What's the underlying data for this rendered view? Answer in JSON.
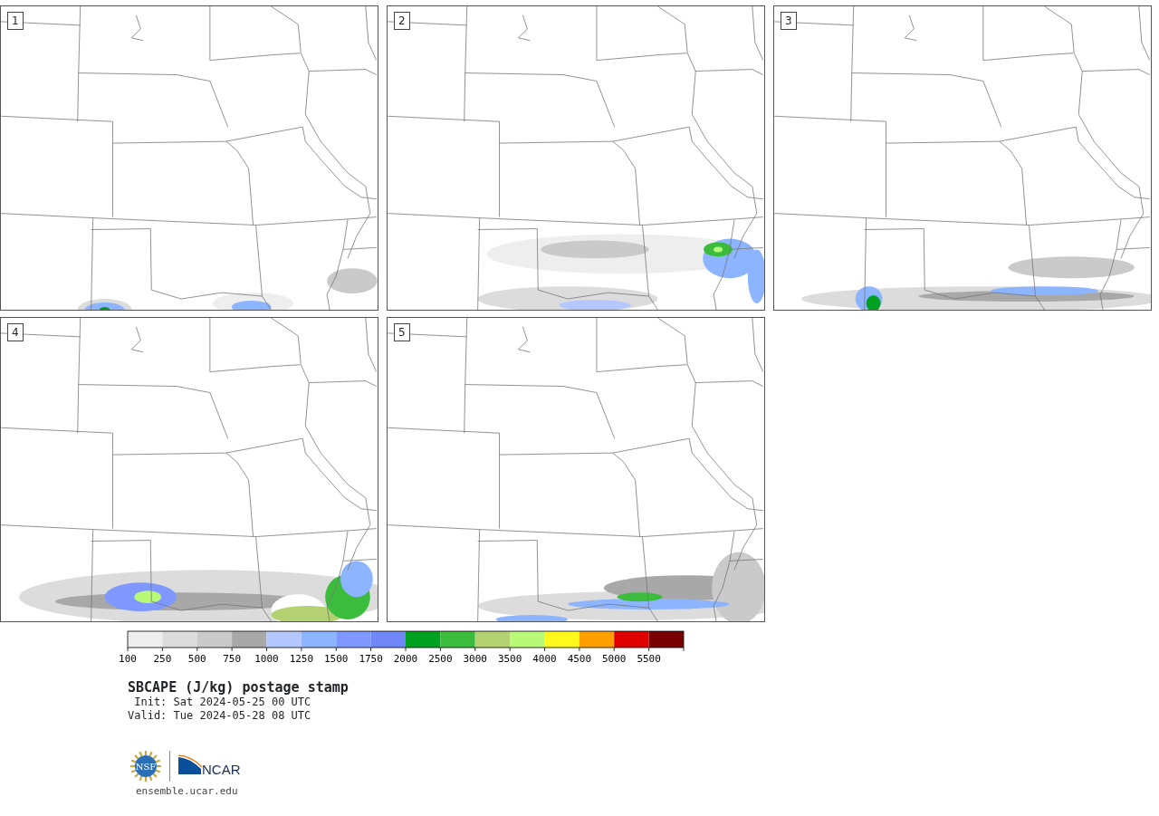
{
  "panels": [
    {
      "label": "1"
    },
    {
      "label": "2"
    },
    {
      "label": "3"
    },
    {
      "label": "4"
    },
    {
      "label": "5"
    }
  ],
  "colorbar": {
    "bins": [
      {
        "color": "#eeeeee"
      },
      {
        "color": "#dcdcdc"
      },
      {
        "color": "#cacaca"
      },
      {
        "color": "#a8a8a8"
      },
      {
        "color": "#b4c8ff"
      },
      {
        "color": "#8cb4ff"
      },
      {
        "color": "#7f98ff"
      },
      {
        "color": "#7088f8"
      },
      {
        "color": "#00a020"
      },
      {
        "color": "#3cbc3c"
      },
      {
        "color": "#b4d272"
      },
      {
        "color": "#b8fa78"
      },
      {
        "color": "#fff81c"
      },
      {
        "color": "#ffa000"
      },
      {
        "color": "#e10000"
      },
      {
        "color": "#780000"
      }
    ],
    "tick_labels": [
      "100",
      "250",
      "500",
      "750",
      "1000",
      "1250",
      "1500",
      "1750",
      "2000",
      "2500",
      "3000",
      "3500",
      "4000",
      "4500",
      "5000",
      "5500"
    ]
  },
  "title": "SBCAPE (J/kg) postage stamp",
  "init": " Init: Sat 2024-05-25 00 UTC",
  "valid": "Valid: Tue 2024-05-28 08 UTC",
  "logo": {
    "nsf_text": "NSF",
    "ncar_text": "NCAR"
  },
  "url": "ensemble.ucar.edu"
}
